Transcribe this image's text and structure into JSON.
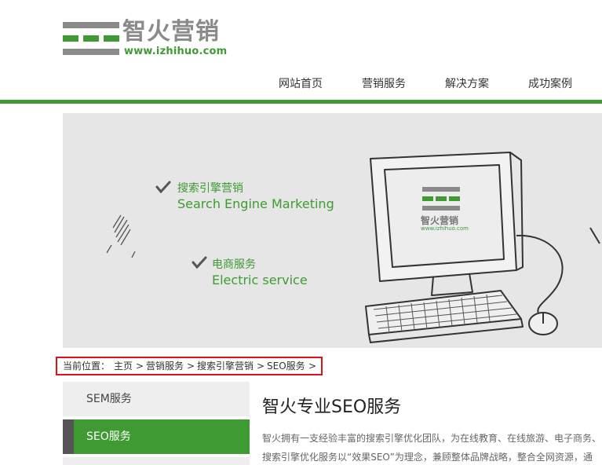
{
  "header": {
    "logo_cn": "智火营销",
    "logo_url": "www.izhihuo.com"
  },
  "nav": {
    "items": [
      {
        "label": "网站首页"
      },
      {
        "label": "营销服务"
      },
      {
        "label": "解决方案"
      },
      {
        "label": "成功案例"
      }
    ]
  },
  "banner": {
    "features": [
      {
        "cn": "搜索引擎营销",
        "en": "Search Engine Marketing"
      },
      {
        "cn": "电商服务",
        "en": "Electric service"
      }
    ],
    "screen_logo_cn": "智火营销",
    "screen_logo_url": "www.izhihuo.com"
  },
  "breadcrumb": {
    "prefix": "当前位置：",
    "items": [
      "主页",
      "营销服务",
      "搜索引擎营销",
      "SEO服务"
    ],
    "separator": ">"
  },
  "side_menu": {
    "items": [
      {
        "label": "SEM服务",
        "active": false
      },
      {
        "label": "SEO服务",
        "active": true
      }
    ]
  },
  "main": {
    "title": "智火专业SEO服务",
    "paragraph_lines": [
      "智火拥有一支经验丰富的搜索引擎优化团队，为在线教育、在线旅游、电子商务、",
      "搜索引擎优化服务以“效果SEO”为理念，兼顾整体品牌战略，整合全网资源，通"
    ]
  },
  "colors": {
    "brand_green": "#3f9a34",
    "logo_gray": "#8a8a8a",
    "highlight_red": "#d9141b",
    "banner_bg": "#e6e6e6"
  }
}
